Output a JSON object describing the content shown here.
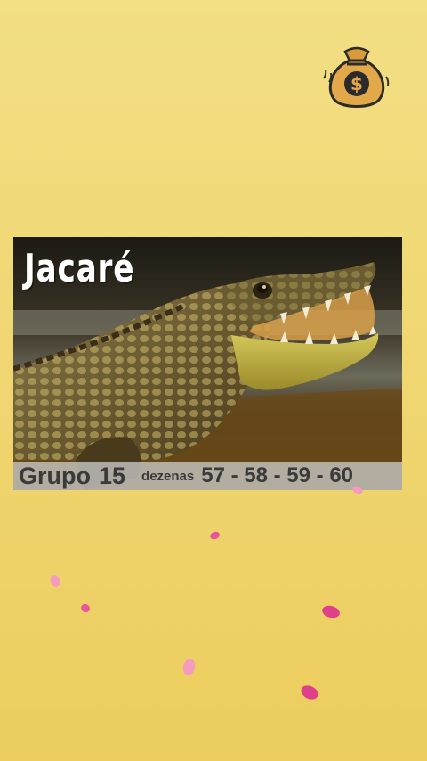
{
  "card": {
    "title": "Jacaré",
    "group_label": "Grupo",
    "group_number": "15",
    "dezenas_label": "dezenas",
    "dezenas_values": "57 - 58 - 59 - 60"
  },
  "icons": {
    "money_bag": "money-bag-icon",
    "money_bag_symbol": "$"
  },
  "colors": {
    "background_top": "#f3df84",
    "background_bottom": "#eccd5e",
    "petal_pink": "#e8559a",
    "petal_light": "#f59bbf"
  }
}
